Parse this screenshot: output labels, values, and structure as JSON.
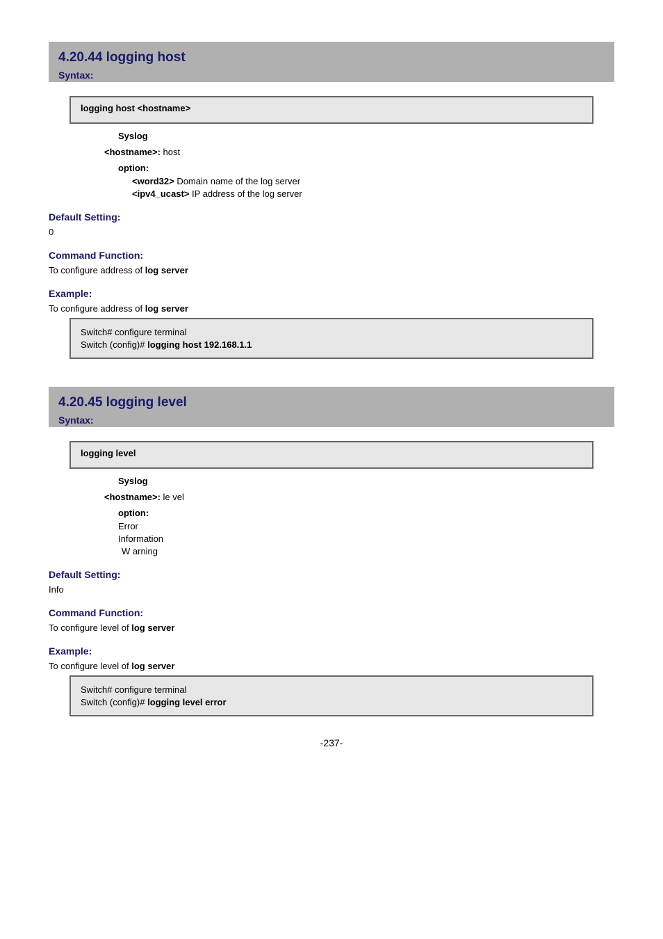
{
  "section1": {
    "title": "4.20.44 logging host",
    "subSyntax": "Syntax:",
    "syntaxBox": "logging host <hostname>",
    "modGroup": "Syslog",
    "modPrefix": "<hostname>:",
    "modValue": "host",
    "optsLabel": "option:",
    "opt1Key": "<word32>",
    "opt1Desc": " Domain name of the log server",
    "opt2Key": "<ipv4_ucast>",
    "opt2Desc": " IP address of the log server",
    "subDefault": "Default Setting:",
    "defaultVal": "0",
    "subFunc": "Command Function:",
    "funcText": "To configure address of ",
    "funcSuffix": "log server",
    "subExample": "Example:",
    "exampleText": "To configure address of ",
    "exampleSuffix": "log server",
    "codeLine1": "Switch# configure terminal",
    "codeLine2": "Switch (config)# ",
    "codeBold2": "logging host 192.168.1.1"
  },
  "section2": {
    "title": "4.20.45 logging level",
    "subSyntax": "Syntax:",
    "syntaxBox": "logging level",
    "modGroup": "Syslog",
    "modPrefix": "<hostname>:",
    "modValue": "le vel",
    "optsLabel": "option:",
    "opt1": "Error",
    "opt2": "Information",
    "opt3": "W arning",
    "subDefault": "Default Setting:",
    "defaultVal": "Info",
    "subFunc": "Command Function:",
    "funcText": "To configure level of ",
    "funcSuffix": "log server",
    "subExample": "Example:",
    "exampleText": "To configure level of ",
    "exampleSuffix": "log server",
    "codeLine1": "Switch# configure terminal",
    "codeLine2": "Switch (config)# ",
    "codeBold2": "logging level error"
  },
  "footer": "-237-"
}
